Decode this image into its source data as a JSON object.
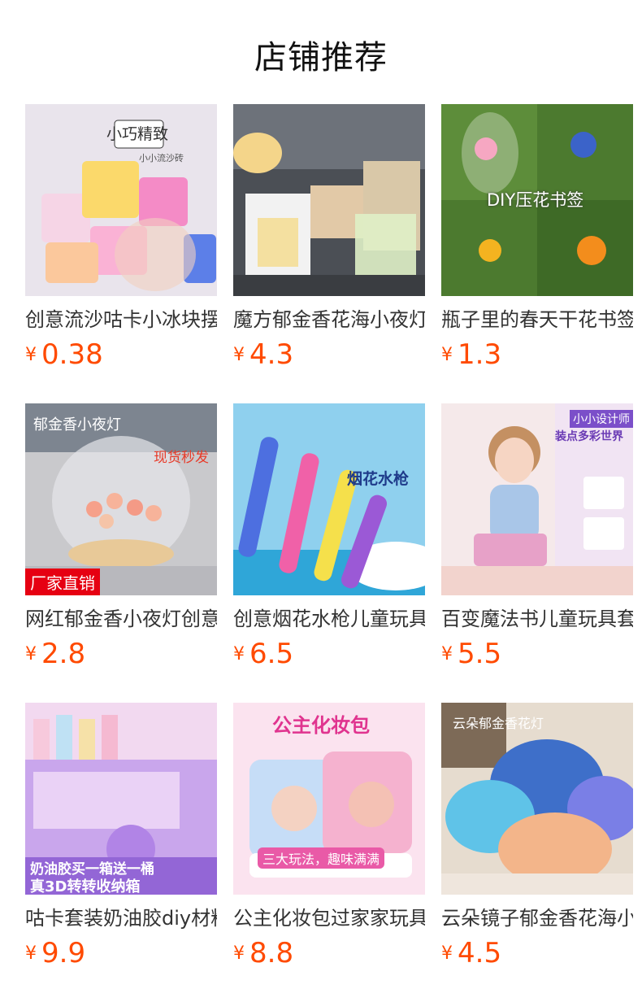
{
  "header": {
    "title": "店铺推荐"
  },
  "currency_symbol": "¥",
  "colors": {
    "price": "#ff4a00",
    "badge_bg": "#e60012"
  },
  "products": [
    {
      "name": "创意流沙咕卡小冰块摆件",
      "price": "0.38",
      "image_text": "小巧精致",
      "image_subtext": "小小流沙砖"
    },
    {
      "name": "魔方郁金香花海小夜灯",
      "price": "4.3"
    },
    {
      "name": "瓶子里的春天干花书签",
      "price": "1.3",
      "image_text": "DIY压花书签"
    },
    {
      "name": "网红郁金香小夜灯创意",
      "price": "2.8",
      "image_text": "郁金香小夜灯",
      "image_subtext": "现货秒发",
      "badge": "厂家直销"
    },
    {
      "name": "创意烟花水枪儿童玩具",
      "price": "6.5",
      "image_text": "烟花水枪"
    },
    {
      "name": "百变魔法书儿童玩具套装",
      "price": "5.5",
      "image_text": "小小设计师",
      "image_subtext": "装点多彩世界"
    },
    {
      "name": "咕卡套装奶油胶diy材料",
      "price": "9.9",
      "image_text": "奶油胶买一箱送一桶",
      "image_subtext": "真3D转转收纳箱"
    },
    {
      "name": "公主化妆包过家家玩具",
      "price": "8.8",
      "image_text": "公主化妆包",
      "image_subtext": "三大玩法，趣味满满"
    },
    {
      "name": "云朵镜子郁金香花海小夜灯",
      "price": "4.5",
      "image_text": "云朵郁金香花灯"
    }
  ]
}
